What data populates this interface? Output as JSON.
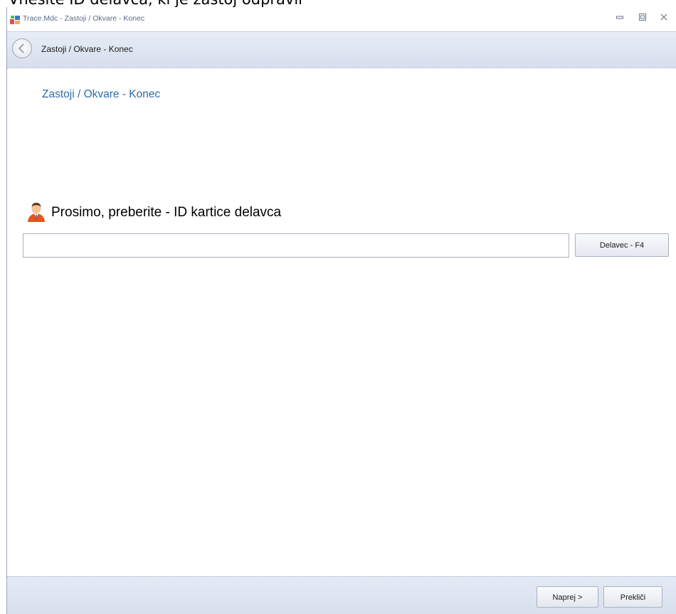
{
  "caption": {
    "text": "Vnesite ID delavca, ki je zastoj odpravil"
  },
  "window": {
    "title": "Trace.Mdc - Zastoji / Okvare - Konec",
    "controls": {
      "minimize": "▭",
      "restore": "⧉",
      "close": "✕"
    }
  },
  "nav": {
    "title": "Zastoji / Okvare - Konec"
  },
  "main": {
    "heading": "Zastoji / Okvare - Konec",
    "prompt": "Prosimo, preberite  - ID kartice delavca",
    "input_value": "",
    "worker_button": "Delavec - F4"
  },
  "footer": {
    "next_button": "Naprej >",
    "cancel_button": "Prekliči"
  },
  "colors": {
    "heading": "#2b6ea8",
    "nav_background": "#dbe3f0"
  }
}
